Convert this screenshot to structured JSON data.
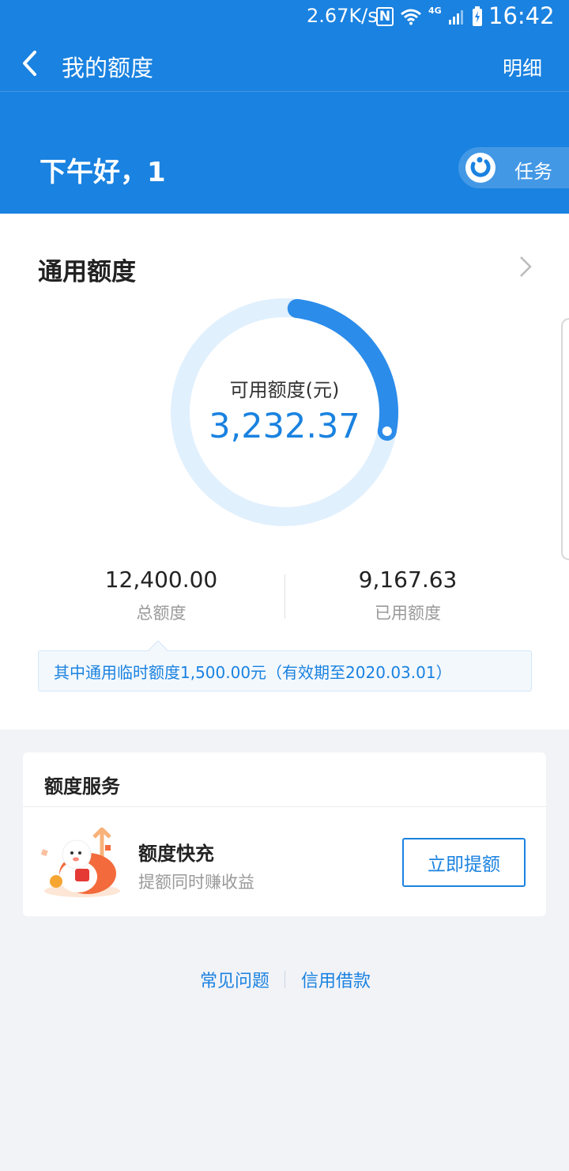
{
  "status_bar": {
    "speed": "2.67K/s",
    "network": "4G",
    "time": "16:42"
  },
  "header": {
    "title": "我的额度",
    "detail_label": "明细"
  },
  "hero": {
    "greeting": "下午好，1",
    "task_label": "任务"
  },
  "credit": {
    "section_title": "通用额度",
    "available_label": "可用额度(元)",
    "available_value": "3,232.37",
    "available_fraction": 0.26,
    "total_value": "12,400.00",
    "total_label": "总额度",
    "used_value": "9,167.63",
    "used_label": "已用额度",
    "notice": "其中通用临时额度1,500.00元（有效期至2020.03.01）"
  },
  "service": {
    "section_title": "额度服务",
    "item_name": "额度快充",
    "item_desc": "提额同时赚收益",
    "button_label": "立即提额"
  },
  "footer": {
    "faq_label": "常见问题",
    "credit_label": "信用借款"
  },
  "colors": {
    "brand": "#1a82e0",
    "ring_track": "#e1f0fd",
    "ring_fill": "#2b8cea"
  }
}
